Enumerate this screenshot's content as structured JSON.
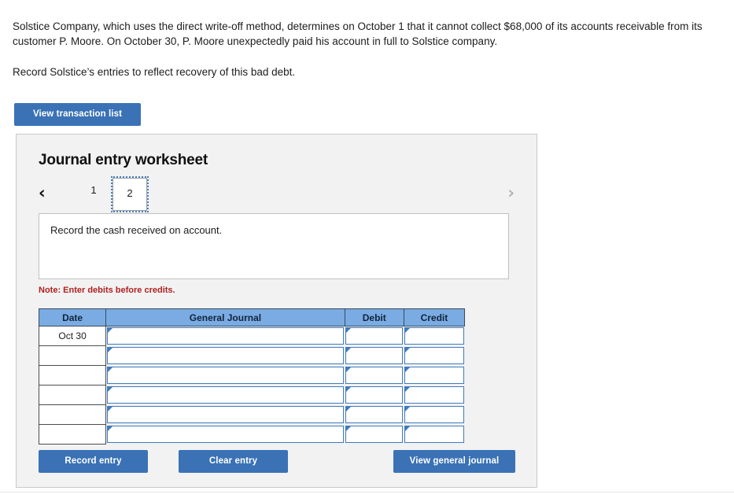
{
  "problem": {
    "paragraph_1": "Solstice Company, which uses the direct write-off method, determines on October 1 that it cannot collect $68,000 of its accounts receivable from its customer P. Moore. On October 30, P. Moore unexpectedly paid his account in full to Solstice company.",
    "paragraph_2": "Record Solstice’s entries to reflect recovery of this bad debt."
  },
  "view_transaction_button": {
    "label": "View transaction list"
  },
  "worksheet": {
    "title": "Journal entry worksheet",
    "nav": {
      "prev_icon": "chevron-left-icon",
      "prev_glyph": "‹",
      "next_icon": "chevron-right-icon",
      "next_glyph": "›"
    },
    "tabs": [
      {
        "label": "1",
        "active": false
      },
      {
        "label": "2",
        "active": true
      }
    ],
    "instruction": "Record the cash received on account.",
    "note": "Note: Enter debits before credits."
  },
  "journal_table": {
    "columns": [
      "Date",
      "General Journal",
      "Debit",
      "Credit"
    ],
    "rows": [
      {
        "date": "Oct 30",
        "general_journal": "",
        "debit": "",
        "credit": ""
      },
      {
        "date": "",
        "general_journal": "",
        "debit": "",
        "credit": ""
      },
      {
        "date": "",
        "general_journal": "",
        "debit": "",
        "credit": ""
      },
      {
        "date": "",
        "general_journal": "",
        "debit": "",
        "credit": ""
      },
      {
        "date": "",
        "general_journal": "",
        "debit": "",
        "credit": ""
      },
      {
        "date": "",
        "general_journal": "",
        "debit": "",
        "credit": ""
      }
    ]
  },
  "actions": {
    "record_entry": "Record entry",
    "clear_entry": "Clear entry",
    "view_general_journal": "View general journal"
  },
  "colors": {
    "button_blue": "#3a72b5",
    "table_header_blue": "#7aabe3",
    "input_border_blue": "#3f7bbf",
    "note_red": "#b02020",
    "panel_background": "#f2f2f2",
    "panel_border": "#c9c9c9"
  }
}
